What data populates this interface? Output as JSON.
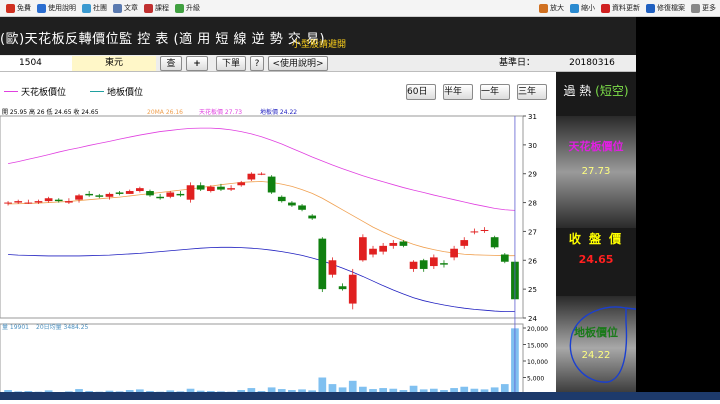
{
  "toolbar": {
    "left_items": [
      {
        "label": "免費",
        "icon": "home-icon",
        "color": "#d03020"
      },
      {
        "label": "使用說明",
        "icon": "help-icon",
        "color": "#2a6dd0"
      },
      {
        "label": "社團",
        "icon": "group-icon",
        "color": "#3a9ad0"
      },
      {
        "label": "文章",
        "icon": "article-icon",
        "color": "#5a7ab0"
      },
      {
        "label": "課程",
        "icon": "course-icon",
        "color": "#c03030"
      },
      {
        "label": "升級",
        "icon": "upgrade-icon",
        "color": "#40a040"
      }
    ],
    "right_items": [
      {
        "label": "放大",
        "icon": "zoom-in-icon",
        "color": "#d07020"
      },
      {
        "label": "縮小",
        "icon": "zoom-out-icon",
        "color": "#2a8ad0"
      },
      {
        "label": "資料更新",
        "icon": "refresh-icon",
        "color": "#d02020"
      },
      {
        "label": "修復檔案",
        "icon": "repair-icon",
        "color": "#2060c0"
      },
      {
        "label": "更多",
        "icon": "more-icon",
        "color": "#888888"
      }
    ]
  },
  "header": {
    "title": "(歐)天花板反轉價位監 控 表 (適 用 短 線 逆 勢 交 易)",
    "subtitle": "小型股請避開"
  },
  "controls": {
    "code": "1504",
    "name": "東元",
    "query_label": "查",
    "add_label": "+",
    "download_label": "下單",
    "question_label": "?",
    "help_label": "<使用說明>",
    "date_label": "基準日：",
    "date_value": "20180316"
  },
  "legend": {
    "ceiling_label": "天花板價位",
    "floor_label": "地板價位",
    "ranges": [
      "60日",
      "半年",
      "一年",
      "三年"
    ]
  },
  "chart_header": {
    "ohlc_text": "開 25.95 高 26 低 24.65 收 24.65",
    "ma_text": "20MA 26.16",
    "ceiling_text": "天花板價 27.73",
    "floor_text": "地板價 24.22",
    "volume_text": "量 19901",
    "volume_ma_text": "20日均量 3484.25"
  },
  "right_panel": {
    "mode_label": "過 熱",
    "mode_value": "(短空)",
    "ceiling_title": "天花板價位",
    "ceiling_value": "27.73",
    "close_title": "收 盤 價",
    "close_value": "24.65",
    "floor_title": "地板價位",
    "floor_value": "24.22"
  },
  "colors": {
    "ceiling": "#e040e0",
    "floor": "#2020c0",
    "ma": "#f0a050",
    "up": "#e02020",
    "down": "#108010",
    "volume": "#80c0f0"
  },
  "chart_data": {
    "type": "candlestick",
    "ylim": [
      24,
      31
    ],
    "yticks": [
      24,
      25,
      26,
      27,
      28,
      29,
      30,
      31
    ],
    "candles": [
      {
        "o": 28.0,
        "h": 28.05,
        "l": 27.9,
        "c": 28.0
      },
      {
        "o": 28.0,
        "h": 28.1,
        "l": 27.95,
        "c": 28.05
      },
      {
        "o": 28.0,
        "h": 28.1,
        "l": 27.95,
        "c": 28.0
      },
      {
        "o": 28.0,
        "h": 28.1,
        "l": 27.95,
        "c": 28.05
      },
      {
        "o": 28.05,
        "h": 28.2,
        "l": 28.0,
        "c": 28.15
      },
      {
        "o": 28.1,
        "h": 28.15,
        "l": 28.0,
        "c": 28.05
      },
      {
        "o": 28.0,
        "h": 28.15,
        "l": 27.95,
        "c": 28.05
      },
      {
        "o": 28.1,
        "h": 28.3,
        "l": 28.0,
        "c": 28.25
      },
      {
        "o": 28.3,
        "h": 28.4,
        "l": 28.2,
        "c": 28.25
      },
      {
        "o": 28.25,
        "h": 28.3,
        "l": 28.15,
        "c": 28.2
      },
      {
        "o": 28.2,
        "h": 28.35,
        "l": 28.1,
        "c": 28.3
      },
      {
        "o": 28.35,
        "h": 28.4,
        "l": 28.25,
        "c": 28.3
      },
      {
        "o": 28.3,
        "h": 28.45,
        "l": 28.3,
        "c": 28.4
      },
      {
        "o": 28.4,
        "h": 28.55,
        "l": 28.35,
        "c": 28.5
      },
      {
        "o": 28.4,
        "h": 28.45,
        "l": 28.2,
        "c": 28.25
      },
      {
        "o": 28.2,
        "h": 28.3,
        "l": 28.1,
        "c": 28.15
      },
      {
        "o": 28.2,
        "h": 28.4,
        "l": 28.15,
        "c": 28.35
      },
      {
        "o": 28.3,
        "h": 28.4,
        "l": 28.2,
        "c": 28.25
      },
      {
        "o": 28.1,
        "h": 28.7,
        "l": 28.0,
        "c": 28.6
      },
      {
        "o": 28.6,
        "h": 28.7,
        "l": 28.4,
        "c": 28.45
      },
      {
        "o": 28.4,
        "h": 28.6,
        "l": 28.35,
        "c": 28.55
      },
      {
        "o": 28.55,
        "h": 28.65,
        "l": 28.4,
        "c": 28.45
      },
      {
        "o": 28.45,
        "h": 28.6,
        "l": 28.4,
        "c": 28.5
      },
      {
        "o": 28.6,
        "h": 28.75,
        "l": 28.55,
        "c": 28.7
      },
      {
        "o": 28.8,
        "h": 29.05,
        "l": 28.75,
        "c": 29.0
      },
      {
        "o": 29.0,
        "h": 29.05,
        "l": 28.95,
        "c": 29.0
      },
      {
        "o": 28.9,
        "h": 28.95,
        "l": 28.3,
        "c": 28.35
      },
      {
        "o": 28.2,
        "h": 28.25,
        "l": 28.0,
        "c": 28.05
      },
      {
        "o": 28.0,
        "h": 28.05,
        "l": 27.85,
        "c": 27.9
      },
      {
        "o": 27.9,
        "h": 27.95,
        "l": 27.7,
        "c": 27.75
      },
      {
        "o": 27.55,
        "h": 27.6,
        "l": 27.4,
        "c": 27.45
      },
      {
        "o": 26.75,
        "h": 26.8,
        "l": 24.9,
        "c": 25.0
      },
      {
        "o": 25.5,
        "h": 26.1,
        "l": 25.4,
        "c": 26.0
      },
      {
        "o": 25.1,
        "h": 25.2,
        "l": 24.95,
        "c": 25.0
      },
      {
        "o": 24.5,
        "h": 25.7,
        "l": 24.3,
        "c": 25.5
      },
      {
        "o": 26.0,
        "h": 26.9,
        "l": 25.95,
        "c": 26.8
      },
      {
        "o": 26.2,
        "h": 26.5,
        "l": 26.1,
        "c": 26.4
      },
      {
        "o": 26.3,
        "h": 26.6,
        "l": 26.2,
        "c": 26.5
      },
      {
        "o": 26.5,
        "h": 26.7,
        "l": 26.4,
        "c": 26.6
      },
      {
        "o": 26.65,
        "h": 26.7,
        "l": 26.45,
        "c": 26.5
      },
      {
        "o": 25.7,
        "h": 26.0,
        "l": 25.6,
        "c": 25.95
      },
      {
        "o": 26.0,
        "h": 26.05,
        "l": 25.6,
        "c": 25.7
      },
      {
        "o": 25.8,
        "h": 26.2,
        "l": 25.7,
        "c": 26.1
      },
      {
        "o": 25.9,
        "h": 26.0,
        "l": 25.75,
        "c": 25.85
      },
      {
        "o": 26.1,
        "h": 26.5,
        "l": 26.0,
        "c": 26.4
      },
      {
        "o": 26.5,
        "h": 26.8,
        "l": 26.4,
        "c": 26.7
      },
      {
        "o": 27.0,
        "h": 27.1,
        "l": 26.9,
        "c": 27.0
      },
      {
        "o": 27.05,
        "h": 27.15,
        "l": 26.95,
        "c": 27.05
      },
      {
        "o": 26.8,
        "h": 26.85,
        "l": 26.4,
        "c": 26.45
      },
      {
        "o": 26.2,
        "h": 26.25,
        "l": 25.9,
        "c": 25.95
      },
      {
        "o": 25.95,
        "h": 26.0,
        "l": 24.65,
        "c": 24.65
      }
    ],
    "ceiling_series": [
      29.35,
      29.42,
      29.5,
      29.58,
      29.66,
      29.75,
      29.83,
      29.9,
      29.98,
      30.05,
      30.12,
      30.2,
      30.27,
      30.34,
      30.4,
      30.46,
      30.5,
      30.54,
      30.57,
      30.58,
      30.58,
      30.56,
      30.52,
      30.46,
      30.38,
      30.28,
      30.16,
      30.03,
      29.88,
      29.73,
      29.58,
      29.44,
      29.3,
      29.17,
      29.05,
      28.93,
      28.82,
      28.72,
      28.62,
      28.52,
      28.43,
      28.35,
      28.26,
      28.18,
      28.1,
      28.02,
      27.94,
      27.87,
      27.8,
      27.75,
      27.73
    ],
    "floor_series": [
      26.2,
      26.18,
      26.17,
      26.16,
      26.15,
      26.15,
      26.15,
      26.15,
      26.16,
      26.17,
      26.18,
      26.2,
      26.22,
      26.24,
      26.27,
      26.3,
      26.33,
      26.36,
      26.39,
      26.42,
      26.44,
      26.45,
      26.45,
      26.44,
      26.42,
      26.39,
      26.35,
      26.3,
      26.24,
      26.17,
      26.08,
      25.98,
      25.86,
      25.73,
      25.59,
      25.44,
      25.28,
      25.12,
      24.97,
      24.83,
      24.7,
      24.6,
      24.52,
      24.45,
      24.39,
      24.34,
      24.3,
      24.27,
      24.24,
      24.22,
      24.22
    ],
    "ma_series": [
      27.95,
      27.96,
      27.97,
      27.98,
      28.0,
      28.02,
      28.04,
      28.07,
      28.1,
      28.13,
      28.16,
      28.19,
      28.23,
      28.27,
      28.31,
      28.35,
      28.39,
      28.43,
      28.47,
      28.52,
      28.57,
      28.62,
      28.66,
      28.7,
      28.72,
      28.73,
      28.7,
      28.64,
      28.56,
      28.45,
      28.32,
      28.15,
      27.95,
      27.75,
      27.55,
      27.35,
      27.15,
      26.98,
      26.82,
      26.68,
      26.55,
      26.45,
      26.37,
      26.3,
      26.25,
      26.21,
      26.19,
      26.18,
      26.17,
      26.16,
      26.16
    ],
    "volume_ylim": [
      0,
      20000
    ],
    "volume_yticks": [
      5000,
      10000,
      15000,
      20000
    ],
    "volume_ytick_labels": [
      "5,000",
      "10,000",
      "15,000",
      "20,000"
    ],
    "volume": [
      1200,
      800,
      900,
      700,
      1100,
      600,
      800,
      1500,
      900,
      700,
      1000,
      800,
      1200,
      1400,
      900,
      700,
      1100,
      800,
      1600,
      1000,
      900,
      800,
      700,
      1200,
      1800,
      900,
      2000,
      1500,
      1200,
      1400,
      1100,
      5000,
      3000,
      2000,
      4000,
      2200,
      1500,
      1800,
      1600,
      1200,
      2500,
      1400,
      1600,
      1200,
      1800,
      2200,
      1600,
      1400,
      2000,
      3000,
      19901
    ]
  }
}
